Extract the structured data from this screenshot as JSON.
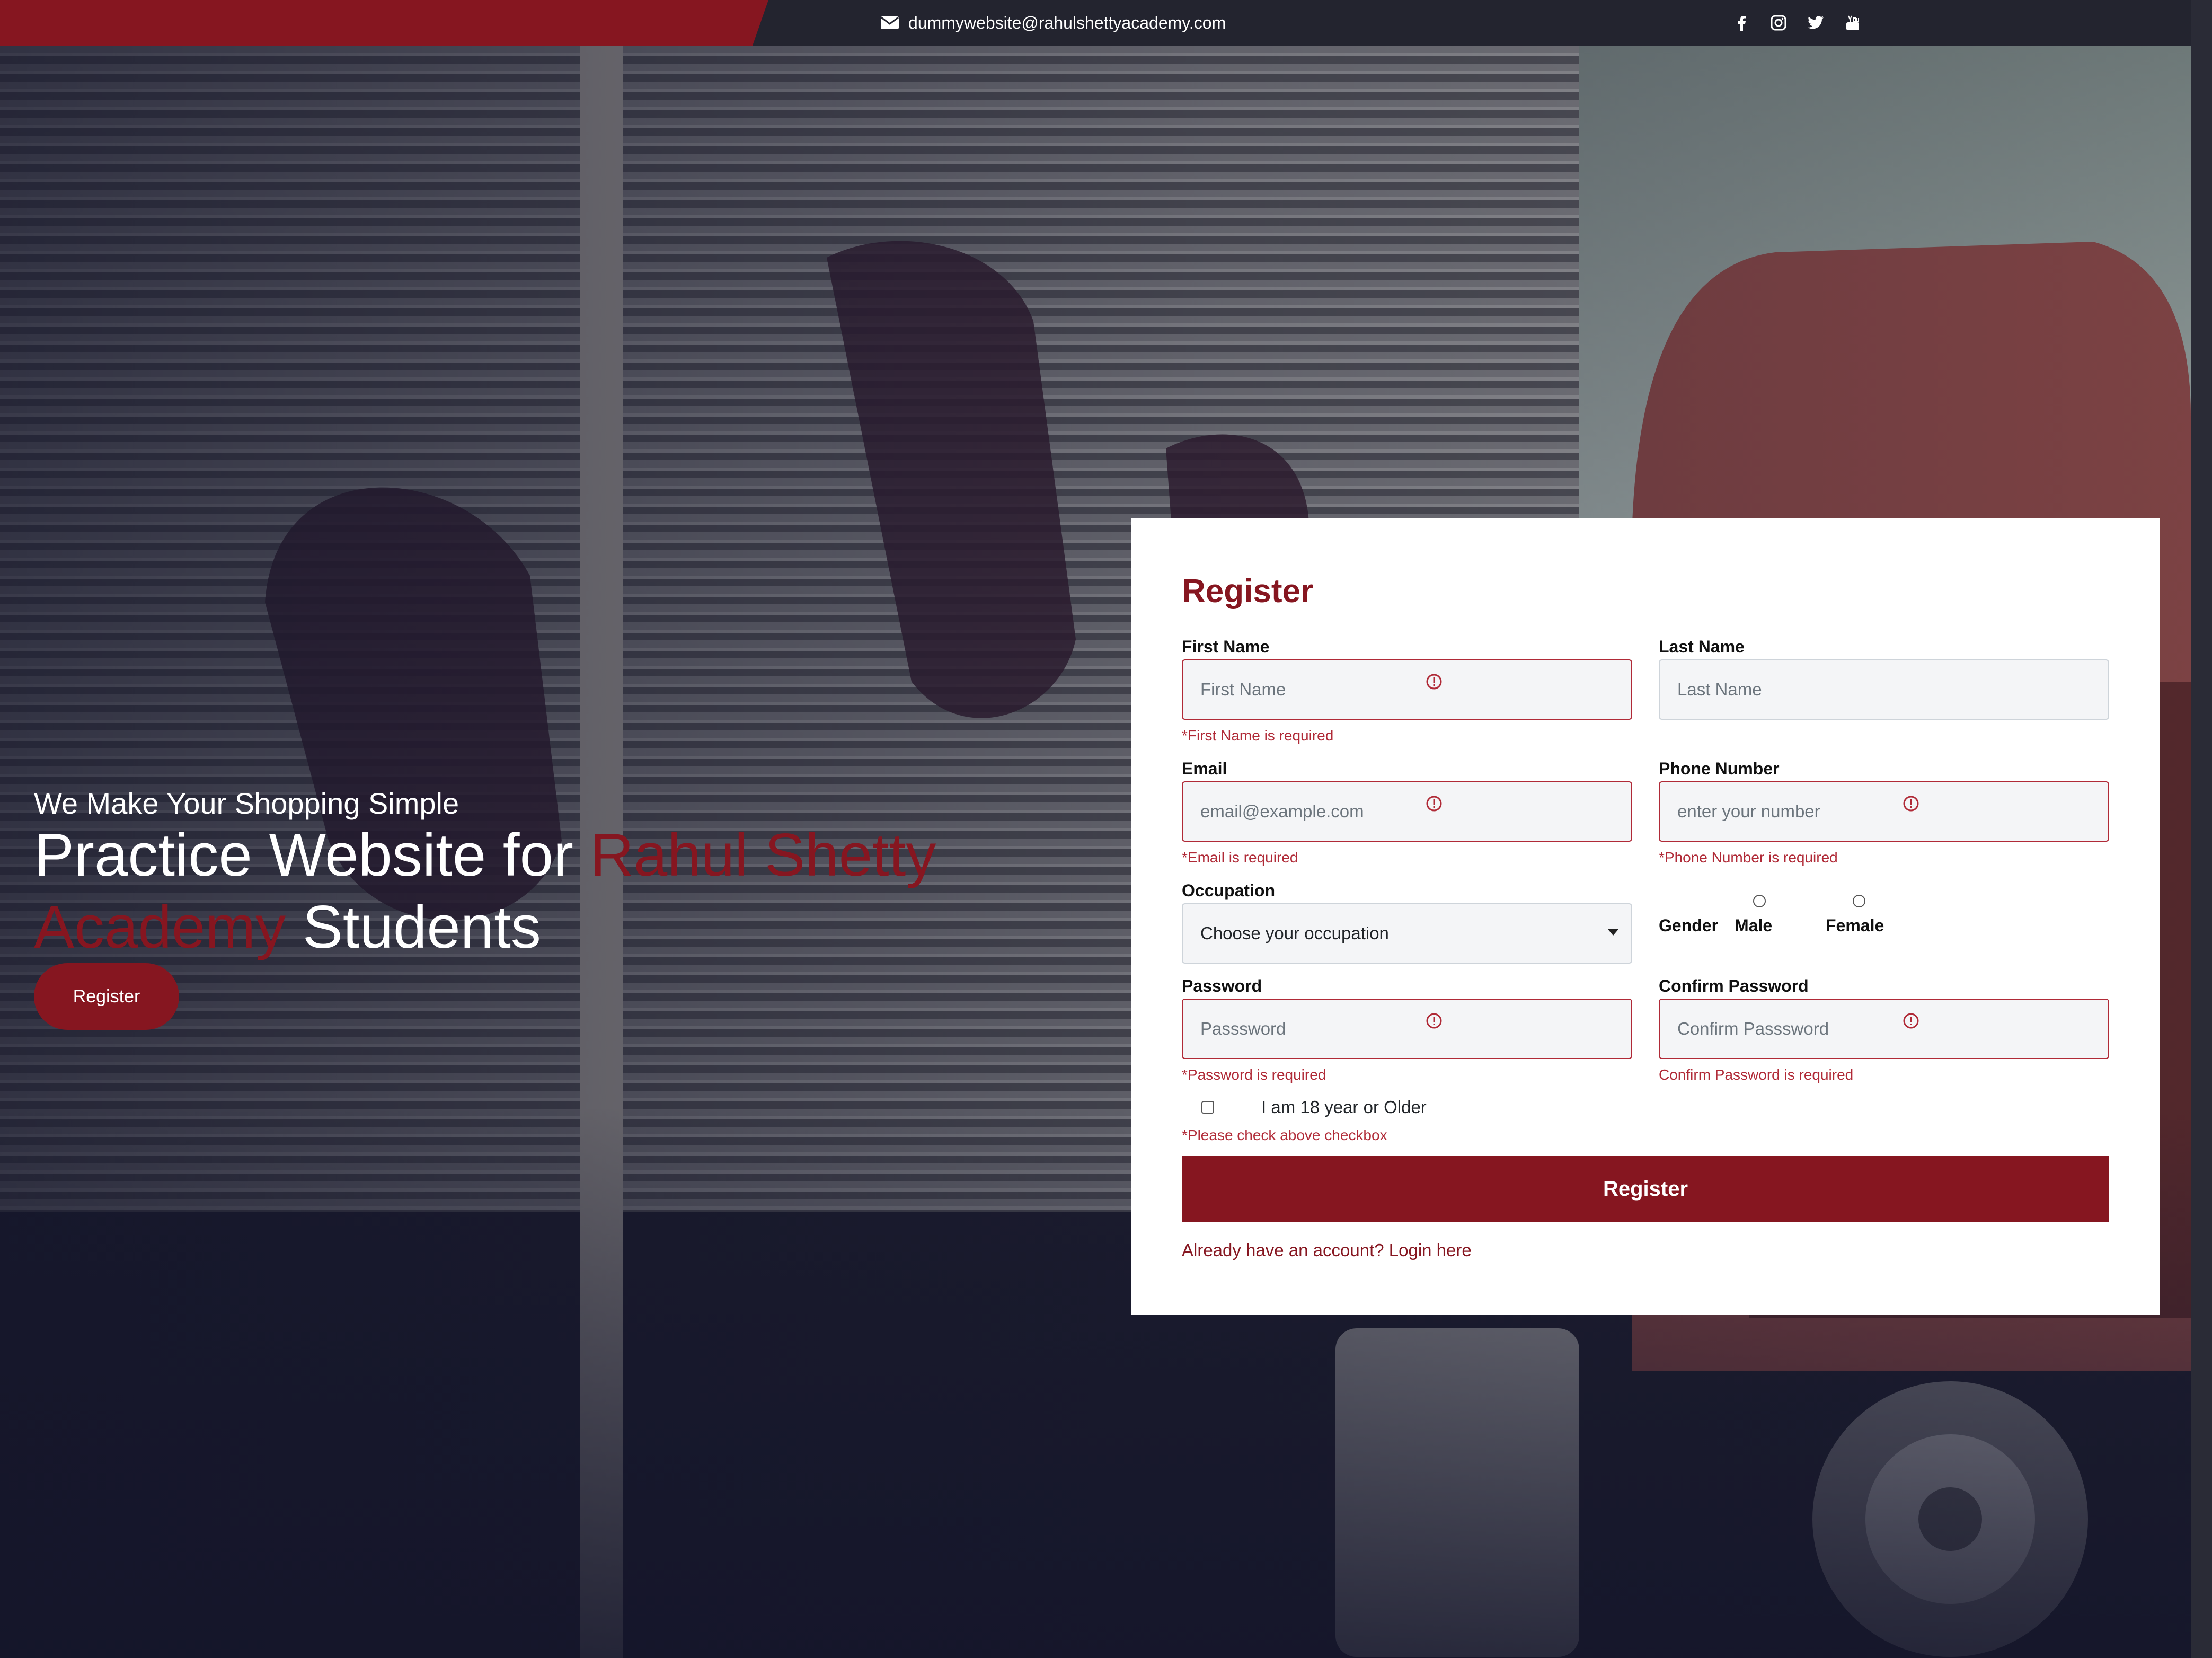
{
  "topbar": {
    "email": "dummywebsite@rahulshettyacademy.com",
    "social_icons": [
      "facebook-icon",
      "instagram-icon",
      "twitter-icon",
      "youtube-icon"
    ]
  },
  "hero": {
    "tagline": "We Make Your Shopping Simple",
    "headline_part1": "Practice Website for ",
    "headline_accent": "Rahul Shetty Academy",
    "headline_part2": " Students",
    "button_label": "Register"
  },
  "form": {
    "title": "Register",
    "first_name": {
      "label": "First Name",
      "placeholder": "First Name",
      "error": "*First Name is required"
    },
    "last_name": {
      "label": "Last Name",
      "placeholder": "Last Name"
    },
    "email": {
      "label": "Email",
      "placeholder": "email@example.com",
      "error": "*Email is required"
    },
    "phone": {
      "label": "Phone Number",
      "placeholder": "enter your number",
      "error": "*Phone Number is required"
    },
    "occupation": {
      "label": "Occupation",
      "selected": "Choose your occupation"
    },
    "gender": {
      "label": "Gender",
      "options": [
        "Male",
        "Female"
      ]
    },
    "password": {
      "label": "Password",
      "placeholder": "Passsword",
      "error": "*Password is required"
    },
    "confirm_password": {
      "label": "Confirm Password",
      "placeholder": "Confirm Passsword",
      "error": "Confirm Password is required"
    },
    "age_check": {
      "label": "I am 18 year or Older",
      "error": "*Please check above checkbox"
    },
    "submit_label": "Register",
    "login_link": "Already have an account? Login here"
  },
  "colors": {
    "brand": "#861620",
    "topbar": "#23242f",
    "error": "#b02a37"
  }
}
